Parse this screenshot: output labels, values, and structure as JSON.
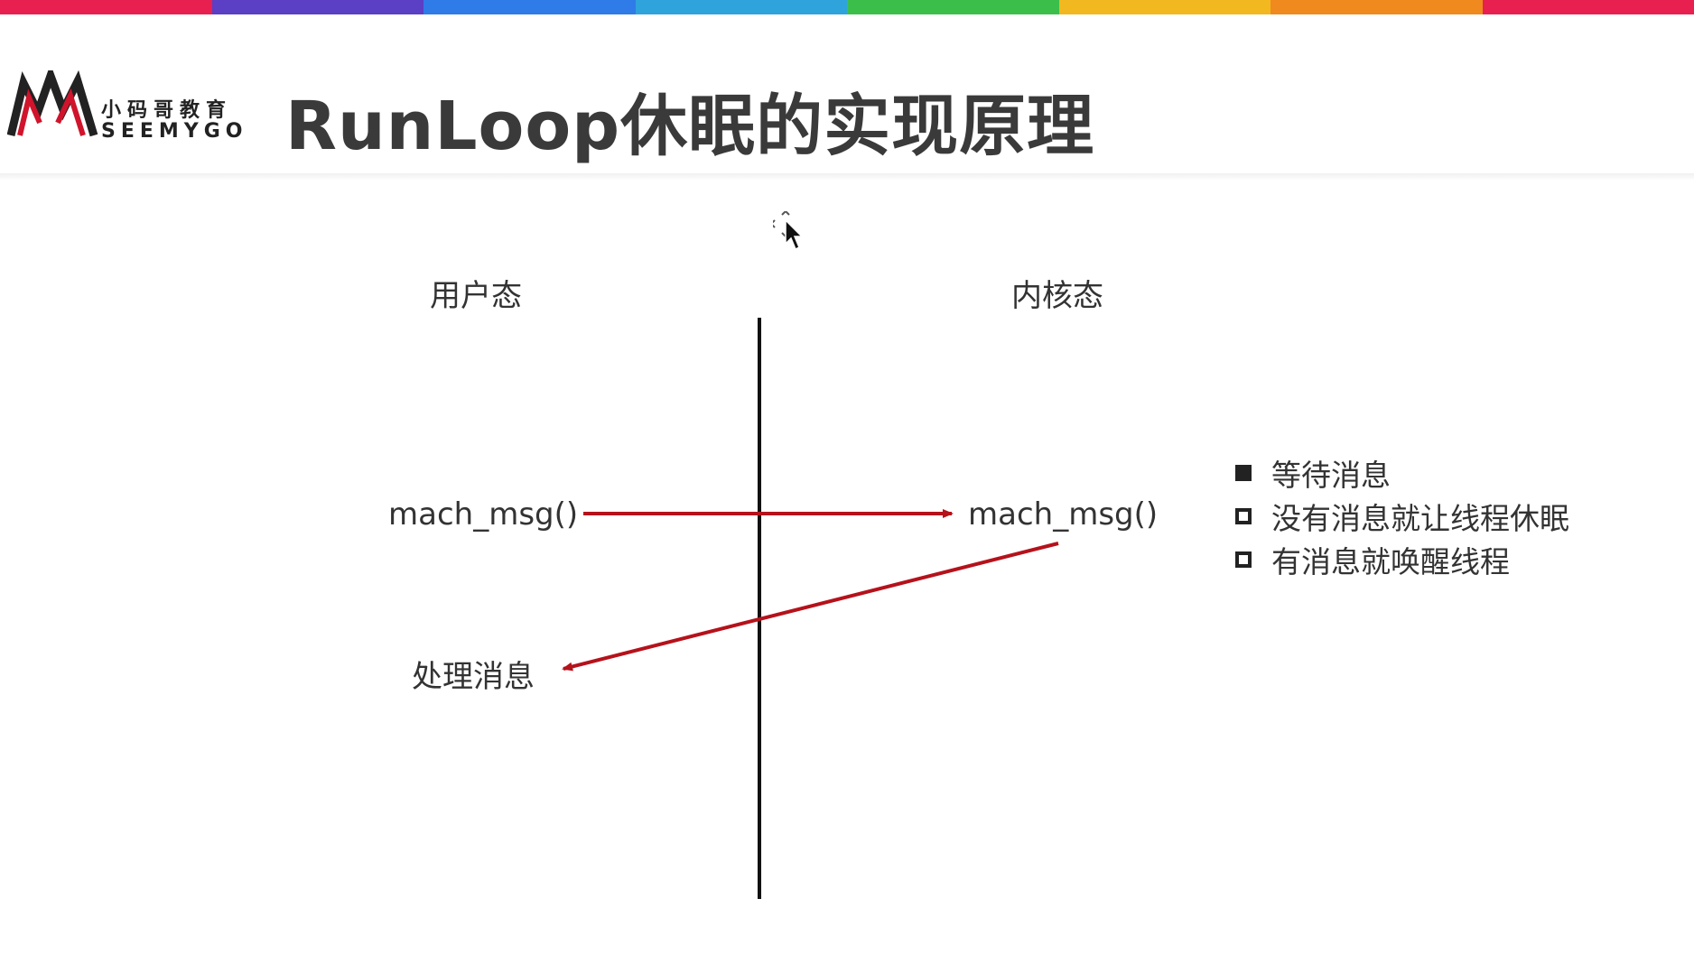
{
  "colors": {
    "rainbow": [
      "#e8204f",
      "#5b3fc4",
      "#2f7be8",
      "#2ea3dc",
      "#3bbf4a",
      "#f2b81f",
      "#f08a1e",
      "#e8204f"
    ],
    "arrow": "#b5121b",
    "axis": "#111111"
  },
  "header": {
    "logo_cn": "小码哥教育",
    "logo_en": "SEEMYGO",
    "title": "RunLoop休眠的实现原理"
  },
  "diagram": {
    "user_mode_label": "用户态",
    "kernel_mode_label": "内核态",
    "left_call": "mach_msg()",
    "right_call": "mach_msg()",
    "process_label": "处理消息"
  },
  "legend": [
    {
      "text": "等待消息",
      "checked": true
    },
    {
      "text": "没有消息就让线程休眠",
      "checked": false
    },
    {
      "text": "有消息就唤醒线程",
      "checked": false
    }
  ]
}
